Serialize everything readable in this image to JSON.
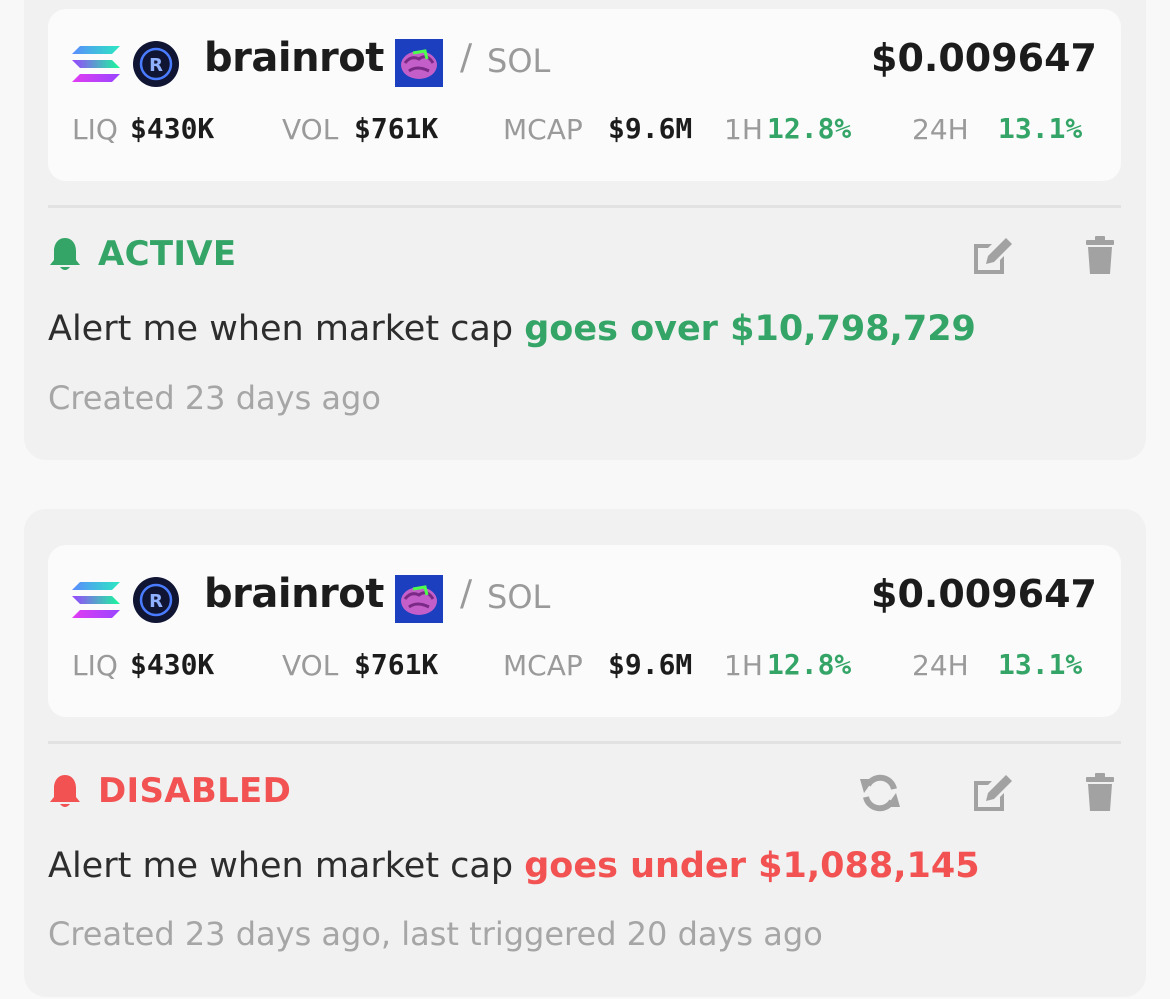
{
  "alerts": [
    {
      "token": {
        "name": "brainrot",
        "quote": "SOL",
        "slash": "/",
        "price": "$0.009647",
        "stats": {
          "liq_label": "LIQ",
          "liq_value": "$430K",
          "vol_label": "VOL",
          "vol_value": "$761K",
          "mcap_label": "MCAP",
          "mcap_value": "$9.6M",
          "h1_label": "1H",
          "h1_value": "12.8%",
          "h24_label": "24H",
          "h24_value": "13.1%"
        }
      },
      "status": "ACTIVE",
      "status_color": "#34a567",
      "alert_prefix": "Alert me when market cap",
      "alert_condition": "goes over $10,798,729",
      "created_text": "Created 23 days ago",
      "actions": [
        "edit-icon",
        "trash-icon"
      ]
    },
    {
      "token": {
        "name": "brainrot",
        "quote": "SOL",
        "slash": "/",
        "price": "$0.009647",
        "stats": {
          "liq_label": "LIQ",
          "liq_value": "$430K",
          "vol_label": "VOL",
          "vol_value": "$761K",
          "mcap_label": "MCAP",
          "mcap_value": "$9.6M",
          "h1_label": "1H",
          "h1_value": "12.8%",
          "h24_label": "24H",
          "h24_value": "13.1%"
        }
      },
      "status": "DISABLED",
      "status_color": "#f25252",
      "alert_prefix": "Alert me when market cap",
      "alert_condition": "goes under $1,088,145",
      "created_text": "Created 23 days ago, last triggered 20 days ago",
      "actions": [
        "refresh-icon",
        "edit-icon",
        "trash-icon"
      ]
    }
  ],
  "colors": {
    "positive": "#34a567",
    "negative": "#f25252",
    "muted": "#9a9a9a"
  }
}
